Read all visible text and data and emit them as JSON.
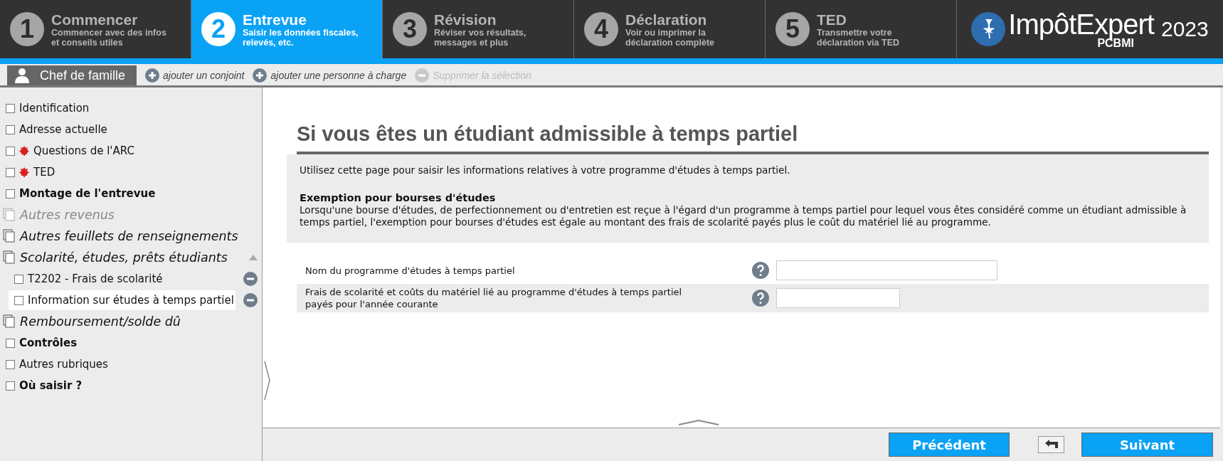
{
  "steps": [
    {
      "number": "1",
      "title": "Commencer",
      "subtitle": "Commencer avec des infos et conseils utiles",
      "selected": false
    },
    {
      "number": "2",
      "title": "Entrevue",
      "subtitle": "Saisir les données fiscales, relevés, etc.",
      "selected": true
    },
    {
      "number": "3",
      "title": "Révision",
      "subtitle": "Réviser vos résultats, messages et plus",
      "selected": false
    },
    {
      "number": "4",
      "title": "Déclaration",
      "subtitle": "Voir ou imprimer la déclaration complète",
      "selected": false
    },
    {
      "number": "5",
      "title": "TED",
      "subtitle": "Transmettre votre déclaration via TED",
      "selected": false
    }
  ],
  "logo": {
    "name": "ImpôtExpert",
    "edition": "PCBMI",
    "year": "2023"
  },
  "person_bar": {
    "person": "Chef de famille",
    "actions": [
      {
        "label": "ajouter un conjoint",
        "disabled": false
      },
      {
        "label": "ajouter une personne à charge",
        "disabled": false
      },
      {
        "label": "Supprimer la sélection",
        "disabled": true
      }
    ]
  },
  "sidebar": {
    "items": [
      {
        "kind": "page",
        "label": "Identification",
        "federal": false
      },
      {
        "kind": "page",
        "label": "Adresse actuelle",
        "federal": false
      },
      {
        "kind": "page",
        "label": "Questions de l'ARC",
        "federal": true
      },
      {
        "kind": "page",
        "label": "TED",
        "federal": true
      },
      {
        "kind": "section",
        "label": "Montage de l'entrevue"
      },
      {
        "kind": "group",
        "label": "Autres revenus",
        "disabled": true,
        "expanded": false
      },
      {
        "kind": "group",
        "label": "Autres feuillets de renseignements",
        "disabled": false,
        "expanded": false
      },
      {
        "kind": "group",
        "label": "Scolarité, études, prêts étudiants",
        "disabled": false,
        "expanded": true,
        "children": [
          {
            "label": "T2202 - Frais de scolarité",
            "selected": false
          },
          {
            "label": "Information sur études à temps partiel",
            "selected": true
          }
        ]
      },
      {
        "kind": "group",
        "label": "Remboursement/solde dû",
        "disabled": false,
        "expanded": false
      },
      {
        "kind": "section",
        "label": "Contrôles"
      },
      {
        "kind": "page",
        "label": "Autres rubriques",
        "federal": false
      },
      {
        "kind": "section",
        "label": "Où saisir ?"
      }
    ]
  },
  "page": {
    "title": "Si vous êtes un étudiant admissible à temps partiel",
    "intro": "Utilisez cette page pour saisir les informations relatives à votre programme d'études à temps partiel.",
    "section_heading": "Exemption pour bourses d'études",
    "section_text": "Lorsqu'une bourse d'études, de perfectionnement ou d'entretien est reçue à l'égard d'un programme à temps partiel pour lequel vous êtes considéré comme un étudiant admissible à temps partiel, l'exemption pour bourses d'études est égale au montant des frais de scolarité payés plus le coût du matériel lié au programme.",
    "fields": [
      {
        "kind": "text",
        "label": "Nom du programme d'études à temps partiel"
      },
      {
        "kind": "amount",
        "label": "Frais de scolarité et coûts du matériel lié au programme d'études à temps partiel payés pour l'année courante"
      }
    ]
  },
  "footer": {
    "previous": "Précédent",
    "next": "Suivant"
  }
}
